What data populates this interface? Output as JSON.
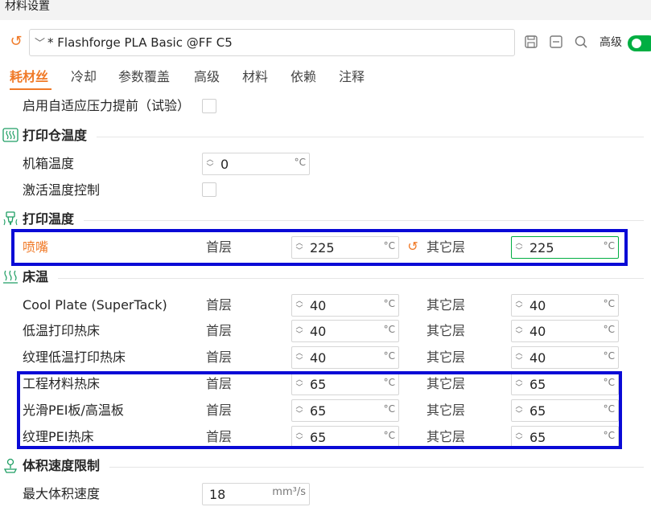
{
  "window": {
    "title": "材料设置"
  },
  "preset": {
    "name": "* Flashforge PLA Basic @FF C5",
    "advanced_label": "高级",
    "advanced_on": true
  },
  "tabs": [
    {
      "label": "耗材丝",
      "active": true
    },
    {
      "label": "冷却"
    },
    {
      "label": "参数覆盖"
    },
    {
      "label": "高级"
    },
    {
      "label": "材料"
    },
    {
      "label": "依赖"
    },
    {
      "label": "注释"
    }
  ],
  "adaptive_pa": {
    "label": "启用自适应压力提前（试验）",
    "checked": false
  },
  "chamber": {
    "title": "打印仓温度",
    "box_temp_label": "机箱温度",
    "box_temp_value": "0",
    "activate_label": "激活温度控制",
    "activate_checked": false
  },
  "print_temp": {
    "title": "打印温度",
    "nozzle_label": "喷嘴",
    "first_layer_label": "首层",
    "first_layer_value": "225",
    "other_layer_label": "其它层",
    "other_layer_value": "225"
  },
  "bed": {
    "title": "床温",
    "rows": [
      {
        "name": "Cool Plate (SuperTack)",
        "first_label": "首层",
        "first": "40",
        "other_label": "其它层",
        "other": "40"
      },
      {
        "name": "低温打印热床",
        "first_label": "首层",
        "first": "40",
        "other_label": "其它层",
        "other": "40"
      },
      {
        "name": "纹理低温打印热床",
        "first_label": "首层",
        "first": "40",
        "other_label": "其它层",
        "other": "40"
      },
      {
        "name": "工程材料热床",
        "first_label": "首层",
        "first": "65",
        "other_label": "其它层",
        "other": "65"
      },
      {
        "name": "光滑PEI板/高温板",
        "first_label": "首层",
        "first": "65",
        "other_label": "其它层",
        "other": "65"
      },
      {
        "name": "纹理PEI热床",
        "first_label": "首层",
        "first": "65",
        "other_label": "其它层",
        "other": "65"
      }
    ]
  },
  "volumetric": {
    "title": "体积速度限制",
    "max_label": "最大体积速度",
    "max_value": "18",
    "max_unit": "mm³/s"
  },
  "units": {
    "temp": "°C"
  },
  "colors": {
    "accent": "#f07a28",
    "highlight": "#0a0ad6",
    "toggle_on": "#00ae42"
  }
}
